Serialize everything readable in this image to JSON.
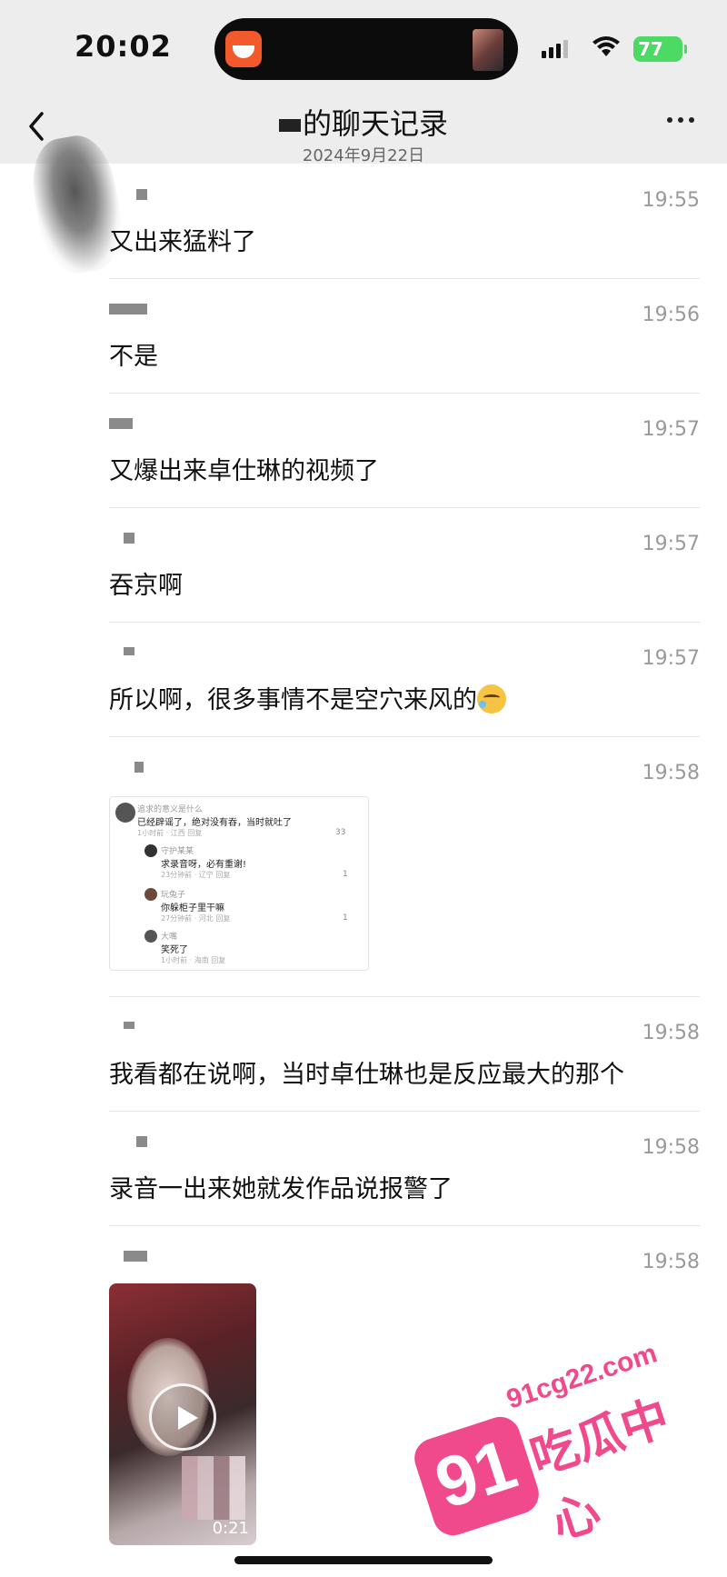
{
  "status_bar": {
    "time": "20:02",
    "battery": "77"
  },
  "header": {
    "title": "的聊天记录",
    "date": "2024年9月22日"
  },
  "messages": [
    {
      "time": "19:55",
      "text": "又出来猛料了"
    },
    {
      "time": "19:56",
      "text": "不是"
    },
    {
      "time": "19:57",
      "text": "又爆出来卓仕琳的视频了"
    },
    {
      "time": "19:57",
      "text": "吞京啊"
    },
    {
      "time": "19:57",
      "text": "所以啊，很多事情不是空穴来风的"
    },
    {
      "time": "19:58",
      "text": ""
    },
    {
      "time": "19:58",
      "text": "我看都在说啊，当时卓仕琳也是反应最大的那个"
    },
    {
      "time": "19:58",
      "text": "录音一出来她就发作品说报警了"
    },
    {
      "time": "19:58",
      "text": ""
    }
  ],
  "screenshot_card": {
    "comments": [
      {
        "name": "追求的意义是什么",
        "body": "已经辟谣了，绝对没有吞，当时就吐了",
        "meta": "1小时前 · 江西   回复",
        "likes": "33"
      },
      {
        "name": "守护某某",
        "body": "求录音呀，必有重谢!",
        "meta": "23分钟前 · 辽宁   回复",
        "likes": "1"
      },
      {
        "name": "玩兔子",
        "body": "你躲柜子里干嘛",
        "meta": "27分钟前 · 河北   回复",
        "likes": "1"
      },
      {
        "name": "大嘴",
        "body": "笑死了",
        "meta": "1小时前 · 海南   回复",
        "likes": ""
      }
    ]
  },
  "video": {
    "duration": "0:21"
  },
  "watermark": {
    "badge": "91",
    "domain": "91cg22.com",
    "name": "吃瓜中心"
  }
}
